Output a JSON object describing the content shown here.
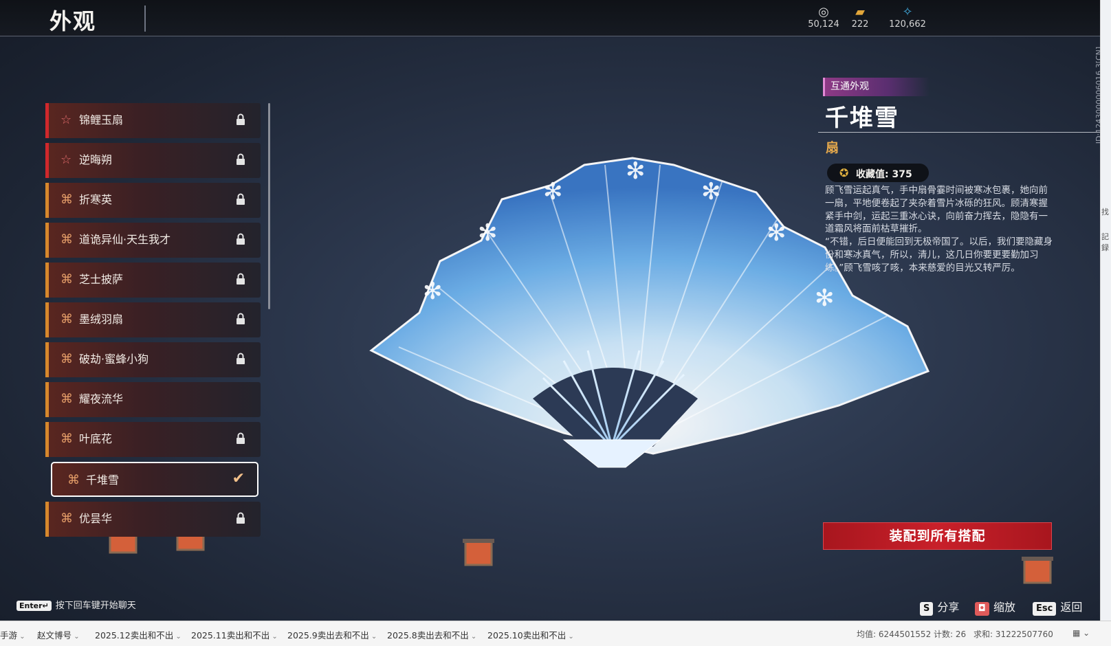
{
  "header": {
    "title": "外观"
  },
  "currencies": [
    {
      "icon": "coin-icon",
      "glyph": "◎",
      "value": "50,124",
      "color": "#d8d8d8"
    },
    {
      "icon": "ticket-icon",
      "glyph": "▰",
      "value": "222",
      "color": "#e2a63a"
    },
    {
      "icon": "feather-icon",
      "glyph": "✧",
      "value": "120,662",
      "color": "#3fa6d8"
    }
  ],
  "side_id": "ID:1243000006016 3[CN]",
  "list": {
    "items": [
      {
        "label": "锦鲤玉扇",
        "rarity": "red",
        "locked": true
      },
      {
        "label": "逆晦朔",
        "rarity": "red",
        "locked": true
      },
      {
        "label": "折寒英",
        "rarity": "orange",
        "locked": true
      },
      {
        "label": "道诡异仙·天生我才",
        "rarity": "orange",
        "locked": true
      },
      {
        "label": "芝士披萨",
        "rarity": "orange",
        "locked": true
      },
      {
        "label": "墨绒羽扇",
        "rarity": "orange",
        "locked": true
      },
      {
        "label": "破劫·蜜蜂小狗",
        "rarity": "orange",
        "locked": true
      },
      {
        "label": "耀夜流华",
        "rarity": "orange",
        "locked": false
      },
      {
        "label": "叶底花",
        "rarity": "orange",
        "locked": true
      },
      {
        "label": "千堆雪",
        "rarity": "orange",
        "locked": false,
        "selected": true
      },
      {
        "label": "优昙华",
        "rarity": "orange",
        "locked": true
      }
    ]
  },
  "detail": {
    "tag": "互通外观",
    "name": "千堆雪",
    "type": "扇",
    "collect_label": "收藏值: 375",
    "description": [
      "顾飞雪运起真气，手中扇骨霎时间被寒冰包裹，她向前一扇，平地便卷起了夹杂着雪片冰砾的狂风。顾清寒握紧手中剑，运起三重冰心诀，向前奋力挥去，隐隐有一道霜风将面前枯草摧折。",
      "“不错，后日便能回到无极帝国了。以后，我们要隐藏身份和寒冰真气，所以，清儿，这几日你要更要勤加习练。”顾飞雪咳了咳，本来慈爱的目光又转严厉。"
    ],
    "equip_button": "装配到所有搭配"
  },
  "footer": {
    "enter_key": "Enter↵",
    "enter_hint": "按下回车键开始聊天",
    "share_key": "S",
    "share_label": "分享",
    "zoom_label": "缩放",
    "back_key": "Esc",
    "back_label": "返回"
  },
  "spreadsheet": {
    "tabs": [
      "手游",
      "赵文博号",
      "2025.12卖出和不出",
      "2025.11卖出和不出",
      "2025.9卖出去和不出",
      "2025.8卖出去和不出",
      "2025.10卖出和不出"
    ],
    "stats": {
      "avg": "均值: 6244501552",
      "count": "计数: 26",
      "sum": "求和: 31222507760"
    }
  },
  "right_strip": [
    "找",
    "記録"
  ]
}
